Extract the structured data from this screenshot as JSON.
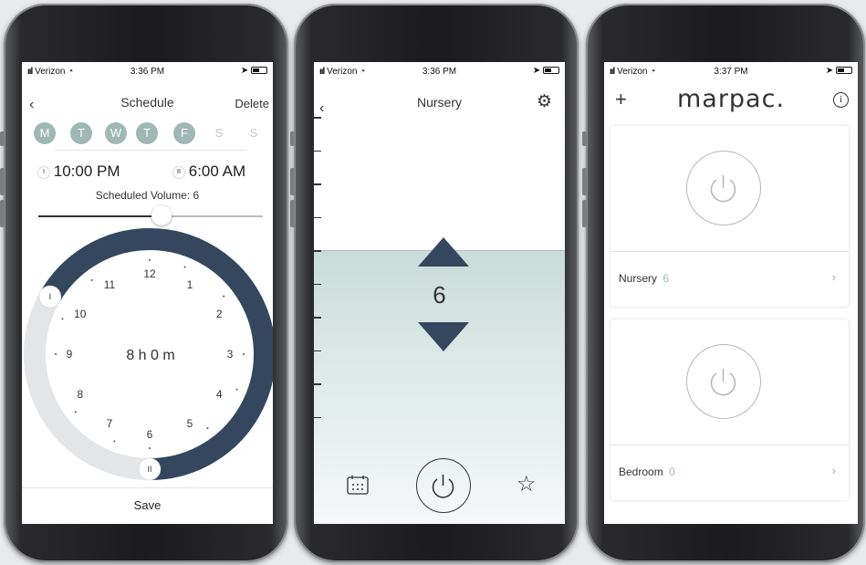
{
  "status": {
    "carrier": "Verizon",
    "time1": "3:36 PM",
    "time2": "3:36 PM",
    "time3": "3:37 PM"
  },
  "schedule": {
    "title": "Schedule",
    "delete_label": "Delete",
    "days": [
      "M",
      "T",
      "W",
      "T",
      "F",
      "S",
      "S"
    ],
    "days_active": [
      true,
      true,
      true,
      true,
      true,
      false,
      false
    ],
    "start_time": "10:00 PM",
    "end_time": "6:00 AM",
    "volume_label": "Scheduled Volume: 6",
    "volume_fraction": 0.55,
    "duration": "8 h 0 m",
    "clock_numbers": [
      "12",
      "1",
      "2",
      "3",
      "4",
      "5",
      "6",
      "7",
      "8",
      "9",
      "10",
      "11"
    ],
    "start_handle": "I",
    "end_handle": "II",
    "save_label": "Save"
  },
  "nursery": {
    "title": "Nursery",
    "volume": "6"
  },
  "home": {
    "brand": "marpac.",
    "devices": [
      {
        "name": "Nursery",
        "volume": "6"
      },
      {
        "name": "Bedroom",
        "volume": "0"
      }
    ]
  },
  "colors": {
    "navy": "#34475e",
    "teal": "#9fb8b5",
    "arc_gray": "#e4e5e7"
  }
}
